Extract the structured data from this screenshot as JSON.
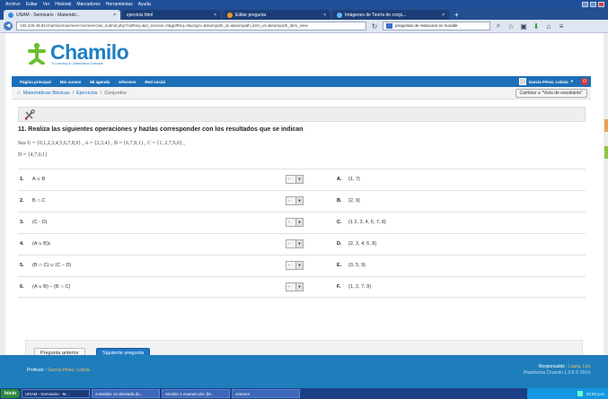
{
  "browser": {
    "menu": [
      "Archivo",
      "Editar",
      "Ver",
      "Historial",
      "Marcadores",
      "Herramientas",
      "Ayuda"
    ],
    "tabs": [
      {
        "label": "UNAM - Seminario - Matemáti...",
        "active": true
      },
      {
        "label": "ejercicio.html",
        "active": false
      },
      {
        "label": "Editar pregunta",
        "active": false
      },
      {
        "label": "Imágenes de Teoría de conju...",
        "active": false
      }
    ],
    "new_tab": "+",
    "url": "132.248.48.81/chamilo/main/exercice/exercise_submit.php?cidReq=&id_session=0&gidReq=0&origin=&learnpath_id=&learnpath_item_id=&learnpath_item_view",
    "search_text": "preguntas de relacionar en moodle"
  },
  "site": {
    "logo_text": "Chamilo",
    "logo_tagline": "E-Learning & Collaboration Software",
    "nav": [
      "Página principal",
      "Mis cursos",
      "Mi agenda",
      "Informes",
      "Red social"
    ],
    "user_name": "García Pérez, Leticia"
  },
  "breadcrumb": {
    "course": "Matemáticas Básicas",
    "sep1": "/",
    "exercises": "Ejercicios",
    "sep2": "/",
    "current": "Conjuntos",
    "student_view_btn": "Cambiar a \"Vista de estudiante\""
  },
  "question": {
    "title": "11. Realiza las siguientes operaciones y hazlas corresponder con los resultados que se indican",
    "desc_line1": "Sea  U = {0,1,2,3,4,5,6,7,8,9} ,  A = {2,3,4} ,  B = {6,7,8,1} ,  C = {1, 2,7,9,0} ,",
    "desc_line2": "D = {4,7,0,1}",
    "rows": [
      {
        "num": "1.",
        "left": "A ∪ B",
        "select": "-",
        "letter": "A.",
        "right": "{1, 7}"
      },
      {
        "num": "2.",
        "left": "B ∩ C",
        "select": "-",
        "letter": "B.",
        "right": "{2, 9}"
      },
      {
        "num": "3.",
        "left": "(C - D)",
        "select": "-",
        "letter": "C.",
        "right": "{1 2, 3, 4, 6, 7, 8}"
      },
      {
        "num": "4.",
        "left": "(A ∪ B)c",
        "select": "-",
        "letter": "D.",
        "right": "{2, 3, 4, 6, 8}"
      },
      {
        "num": "5.",
        "left": "(B ∩ C) ∪ (C − D)",
        "select": "-",
        "letter": "E.",
        "right": "{0, 5, 9}"
      },
      {
        "num": "6.",
        "left": "(A ∪ B) − (B ∩ C)",
        "select": "-",
        "letter": "F.",
        "right": "{1, 2, 7, 9}"
      }
    ]
  },
  "actions": {
    "prev": "Pregunta anterior",
    "next": "Siguiente pregunta"
  },
  "footer": {
    "teacher_label": "Profesor :",
    "teacher_name": "García Pérez, Leticia",
    "responsible_label": "Responsable :",
    "responsible_name": "Laura, Lira",
    "platform": "Plataforma Chamilo 1.9.8 © 2014"
  },
  "taskbar": {
    "start": "Inicio",
    "items": [
      "UNAM - Seminario - M...",
      "a Modulo 12 derivada.do...",
      "Modulo 1 examen.doc [M...",
      "examen"
    ],
    "clock": "02:52 p.m."
  },
  "colors": {
    "brand": "#1e7fc2",
    "nav_bar": "#1b6fb7",
    "primary_button": "#1f78c8",
    "footer": "#1e7ebc"
  }
}
